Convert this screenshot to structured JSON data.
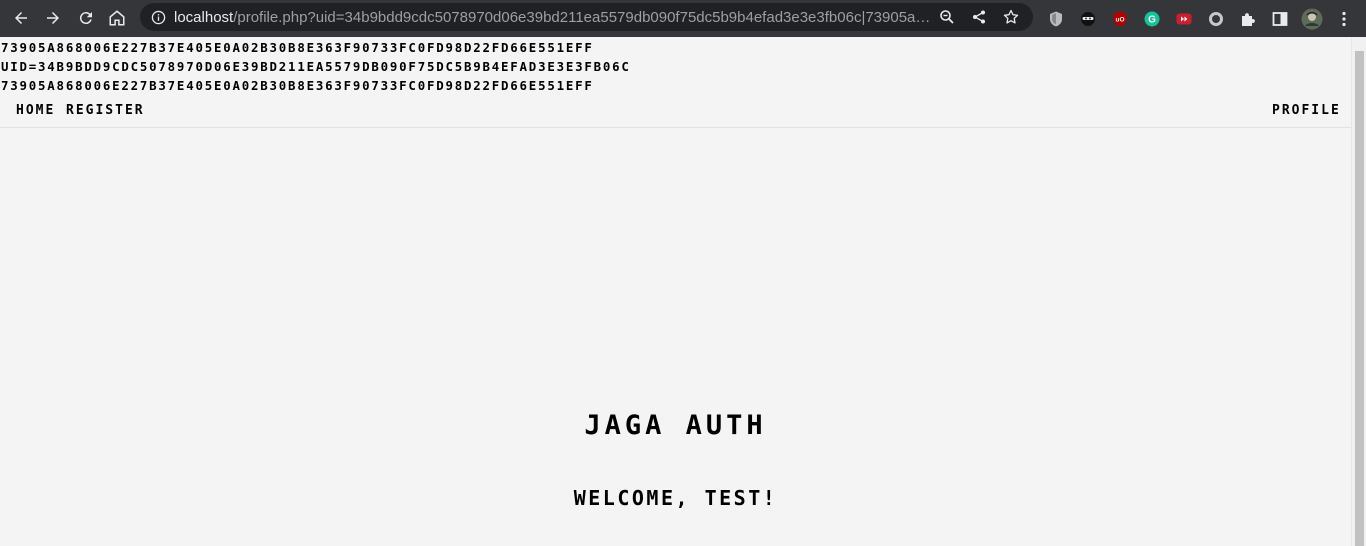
{
  "browser": {
    "url_host": "localhost",
    "url_path": "/profile.php?uid=34b9bdd9cdc5078970d06e39bd211ea5579db090f75dc5b9b4efad3e3e3fb06c|73905a868006e227b37e405e0a02b30b8e363f90733fc0fd98d22fd66e551eff",
    "icons": [
      "back-arrow-icon",
      "forward-arrow-icon",
      "reload-icon",
      "home-icon",
      "info-icon",
      "zoom-icon",
      "share-icon",
      "bookmark-star-icon",
      "extension-icons",
      "puzzle-icon",
      "side-panel-icon",
      "profile-avatar",
      "menu-dots-icon"
    ]
  },
  "debug": {
    "line1": "73905a868006e227b37e405e0a02b30b8e363f90733fc0fd98d22fd66e551eff",
    "line2": "uid=34b9bdd9cdc5078970d06e39bd211ea5579db090f75dc5b9b4efad3e3e3fb06c",
    "line3": "73905a868006e227b37e405e0a02b30b8e363f90733fc0fd98d22fd66e551eff"
  },
  "nav": {
    "home": "home",
    "register": "register",
    "profile": "profile"
  },
  "main": {
    "title": "Jaga Auth",
    "welcome": "Welcome, test!"
  }
}
